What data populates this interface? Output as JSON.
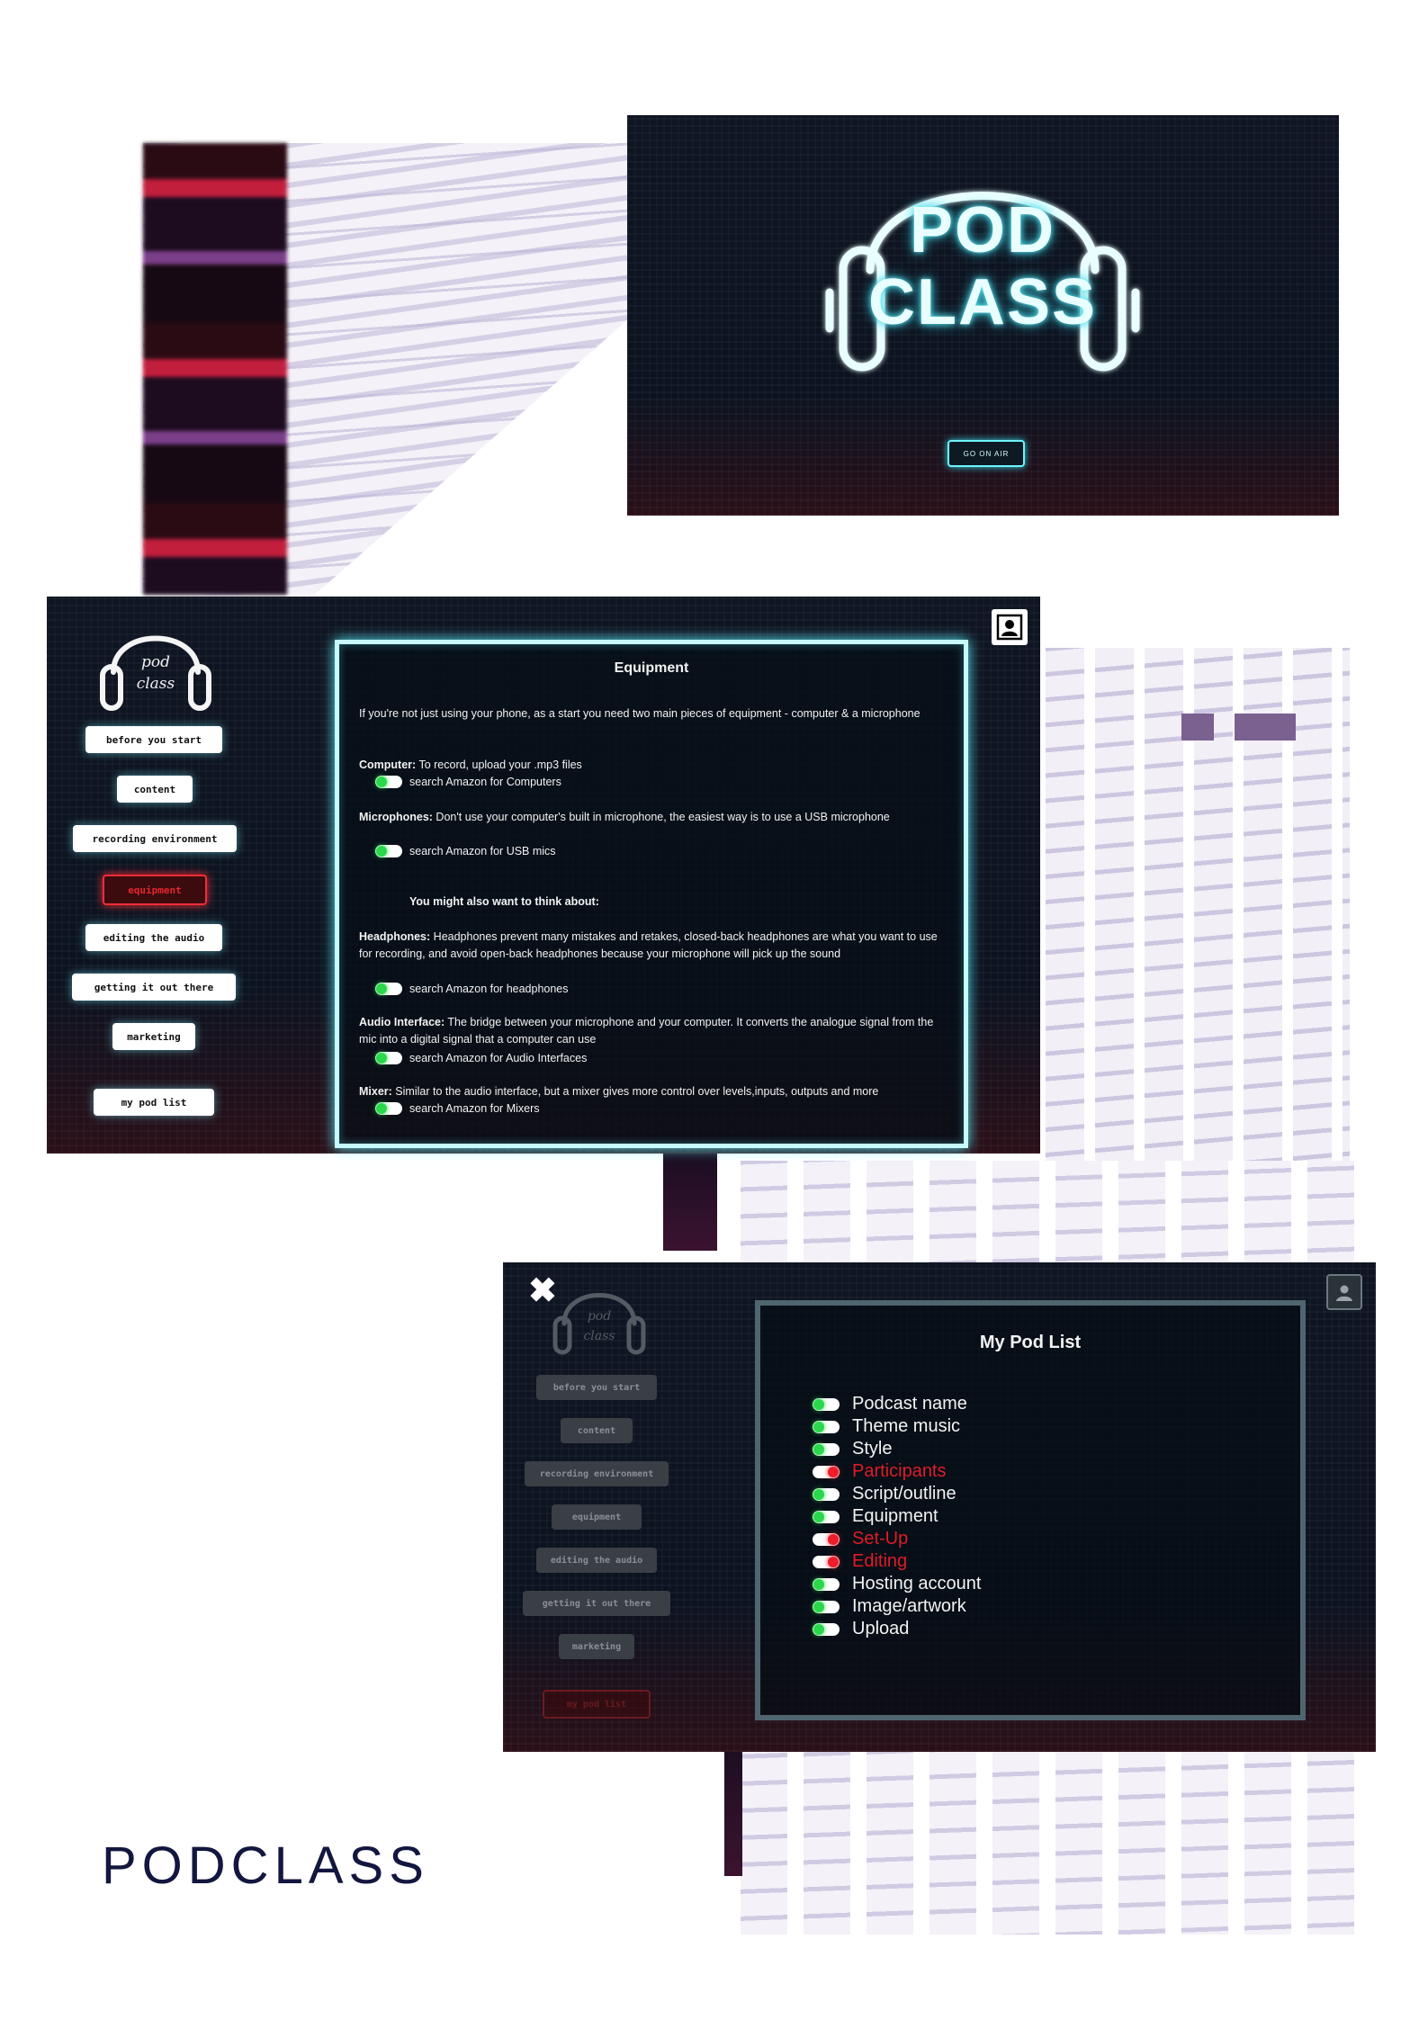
{
  "screen1": {
    "logo_line1": "POD",
    "logo_line2": "CLASS",
    "go_button": "GO ON AIR"
  },
  "screen2": {
    "logo_line1": "pod",
    "logo_line2": "class",
    "nav": [
      {
        "label": "before you start",
        "active": false
      },
      {
        "label": "content",
        "active": false
      },
      {
        "label": "recording environment",
        "active": false
      },
      {
        "label": "equipment",
        "active": true
      },
      {
        "label": "editing the audio",
        "active": false
      },
      {
        "label": "getting it out there",
        "active": false
      },
      {
        "label": "marketing",
        "active": false
      }
    ],
    "my_pod_list": "my pod list",
    "panel": {
      "title": "Equipment",
      "intro": "If you're not just using your phone, as a start you need two main pieces of equipment - computer & a microphone",
      "computer_label": "Computer:",
      "computer_text": " To record, upload your .mp3 files",
      "computer_toggle": "search Amazon for Computers",
      "mics_label": "Microphones:",
      "mics_text": " Don't use your computer's built in microphone, the easiest way is to use a USB microphone",
      "mics_toggle": "search Amazon for USB mics",
      "also_heading": "You might also want to think about:",
      "headphones_label": "Headphones:",
      "headphones_text": " Headphones prevent many mistakes and retakes, closed-back headphones are what you want to use for recording, and avoid open-back headphones because your microphone will pick up the sound",
      "headphones_toggle": "search Amazon for headphones",
      "interface_label": "Audio Interface:",
      "interface_text": " The bridge between your microphone and your computer. It converts the analogue signal from the mic into a digital signal that a computer can use",
      "interface_toggle": "search Amazon for Audio Interfaces",
      "mixer_label": "Mixer:",
      "mixer_text": " Similar to the audio interface, but a mixer gives more control over levels,inputs, outputs and more",
      "mixer_toggle": "search Amazon for Mixers"
    }
  },
  "screen3": {
    "logo_line1": "pod",
    "logo_line2": "class",
    "close_icon": "✖",
    "nav": [
      "before you start",
      "content",
      "recording environment",
      "equipment",
      "editing the audio",
      "getting it out there",
      "marketing"
    ],
    "my_pod_list": "my pod list",
    "title": "My Pod List",
    "items": [
      {
        "label": "Podcast name",
        "done": true
      },
      {
        "label": "Theme music",
        "done": true
      },
      {
        "label": "Style",
        "done": true
      },
      {
        "label": "Participants",
        "done": false
      },
      {
        "label": "Script/outline",
        "done": true
      },
      {
        "label": "Equipment",
        "done": true
      },
      {
        "label": "Set-Up",
        "done": false
      },
      {
        "label": "Editing",
        "done": false
      },
      {
        "label": "Hosting account",
        "done": true
      },
      {
        "label": "Image/artwork",
        "done": true
      },
      {
        "label": "Upload",
        "done": true
      }
    ]
  },
  "brand": "PODCLASS",
  "colors": {
    "neon_cyan": "#5ff0ff",
    "neon_red": "#f02d36",
    "toggle_on": "#2bd84c",
    "toggle_off": "#ee1d2a",
    "brand_text": "#13173f"
  }
}
